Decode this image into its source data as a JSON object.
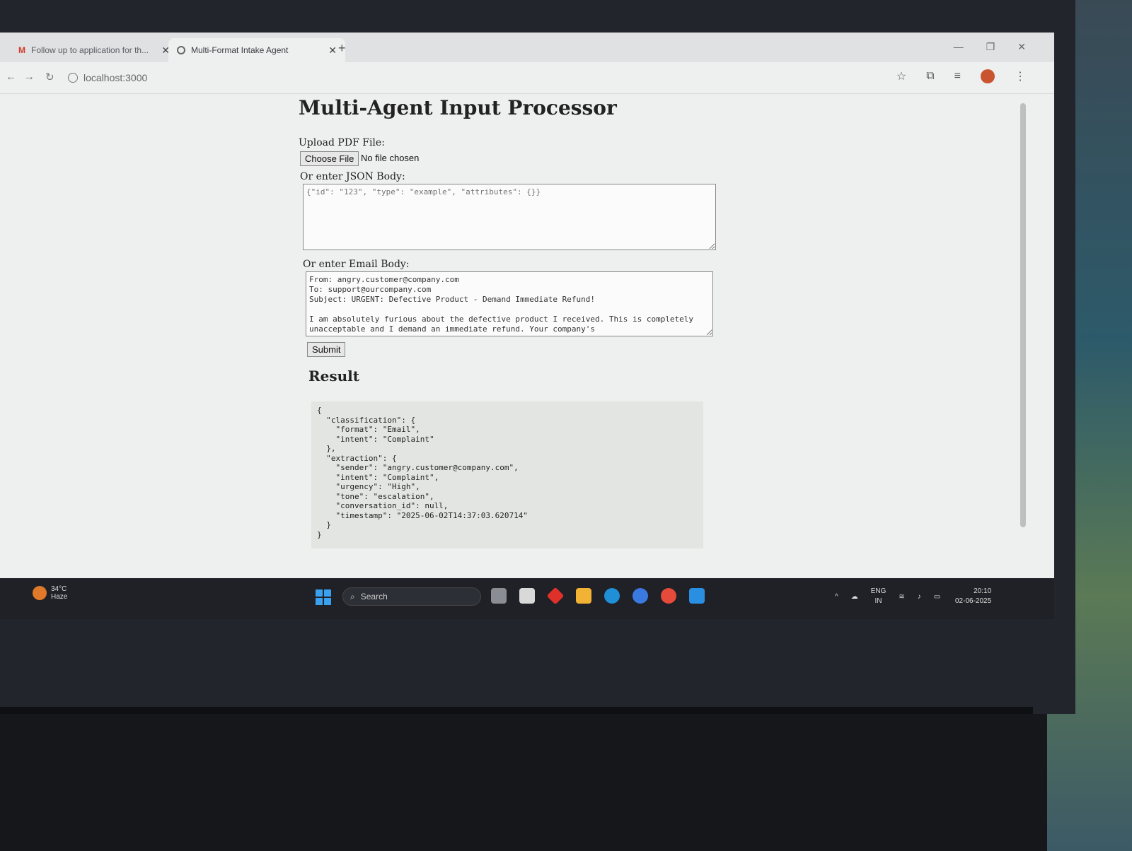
{
  "browser": {
    "tabs": [
      {
        "title": "Follow up to application for th...",
        "icon": "gmail-icon"
      },
      {
        "title": "Multi-Format Intake Agent",
        "icon": "globe-icon"
      }
    ],
    "url": "localhost:3000"
  },
  "page": {
    "title": "Multi-Agent Input Processor",
    "upload_label": "Upload PDF File:",
    "choose_file_label": "Choose File",
    "file_status": "No file chosen",
    "json_label": "Or enter JSON Body:",
    "json_placeholder": "{\"id\": \"123\", \"type\": \"example\", \"attributes\": {}}",
    "email_label": "Or enter Email Body:",
    "email_value": "From: angry.customer@company.com\nTo: support@ourcompany.com\nSubject: URGENT: Defective Product - Demand Immediate Refund!\n\nI am absolutely furious about the defective product I received. This is completely unacceptable and I demand an immediate refund. Your company's",
    "submit_label": "Submit",
    "result_title": "Result",
    "result_json": "{\n  \"classification\": {\n    \"format\": \"Email\",\n    \"intent\": \"Complaint\"\n  },\n  \"extraction\": {\n    \"sender\": \"angry.customer@company.com\",\n    \"intent\": \"Complaint\",\n    \"urgency\": \"High\",\n    \"tone\": \"escalation\",\n    \"conversation_id\": null,\n    \"timestamp\": \"2025-06-02T14:37:03.620714\"\n  }\n}"
  },
  "taskbar": {
    "weather_temp": "34°C",
    "weather_desc": "Haze",
    "search_label": "Search",
    "lang_top": "ENG",
    "lang_bottom": "IN",
    "time": "20:10",
    "date": "02-06-2025"
  }
}
